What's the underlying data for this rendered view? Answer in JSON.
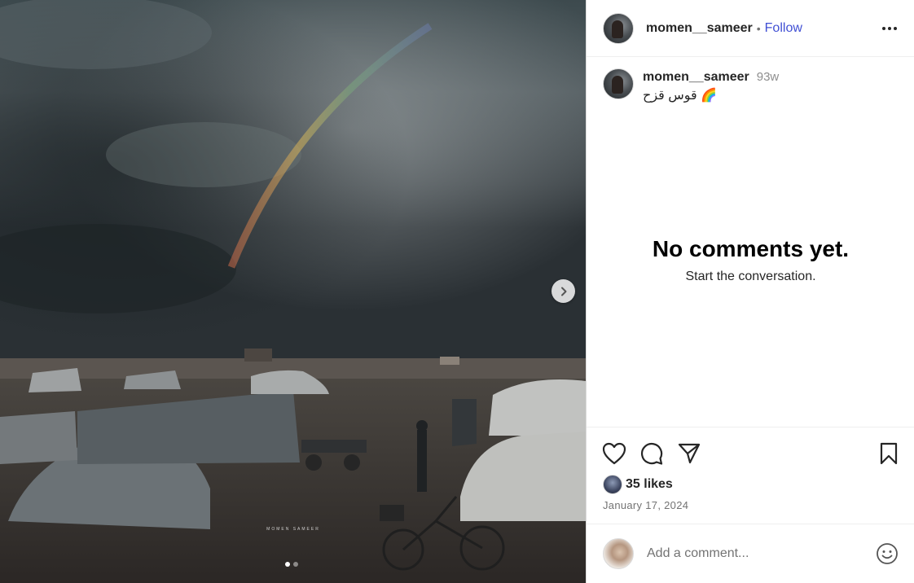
{
  "post": {
    "username": "momen__sameer",
    "follow_label": "Follow",
    "separator": "•",
    "caption_username": "momen__sameer",
    "age": "93w",
    "caption_text": "قوس قزح 🌈",
    "watermark": "MOMEN SAMEER",
    "slides_total": 2,
    "slides_active": 1
  },
  "comments": {
    "empty_title": "No comments yet.",
    "empty_subtitle": "Start the conversation."
  },
  "engagement": {
    "likes_label": "35 likes",
    "date": "January 17, 2024"
  },
  "composer": {
    "placeholder": "Add a comment..."
  },
  "icons": {
    "more": "more-options-icon",
    "like": "heart-icon",
    "comment": "comment-bubble-icon",
    "share": "paper-plane-icon",
    "save": "bookmark-icon",
    "next": "chevron-right-icon",
    "emoji": "smiley-icon"
  },
  "colors": {
    "follow": "#4150d4",
    "muted": "#737373",
    "border": "#dbdbdb"
  }
}
